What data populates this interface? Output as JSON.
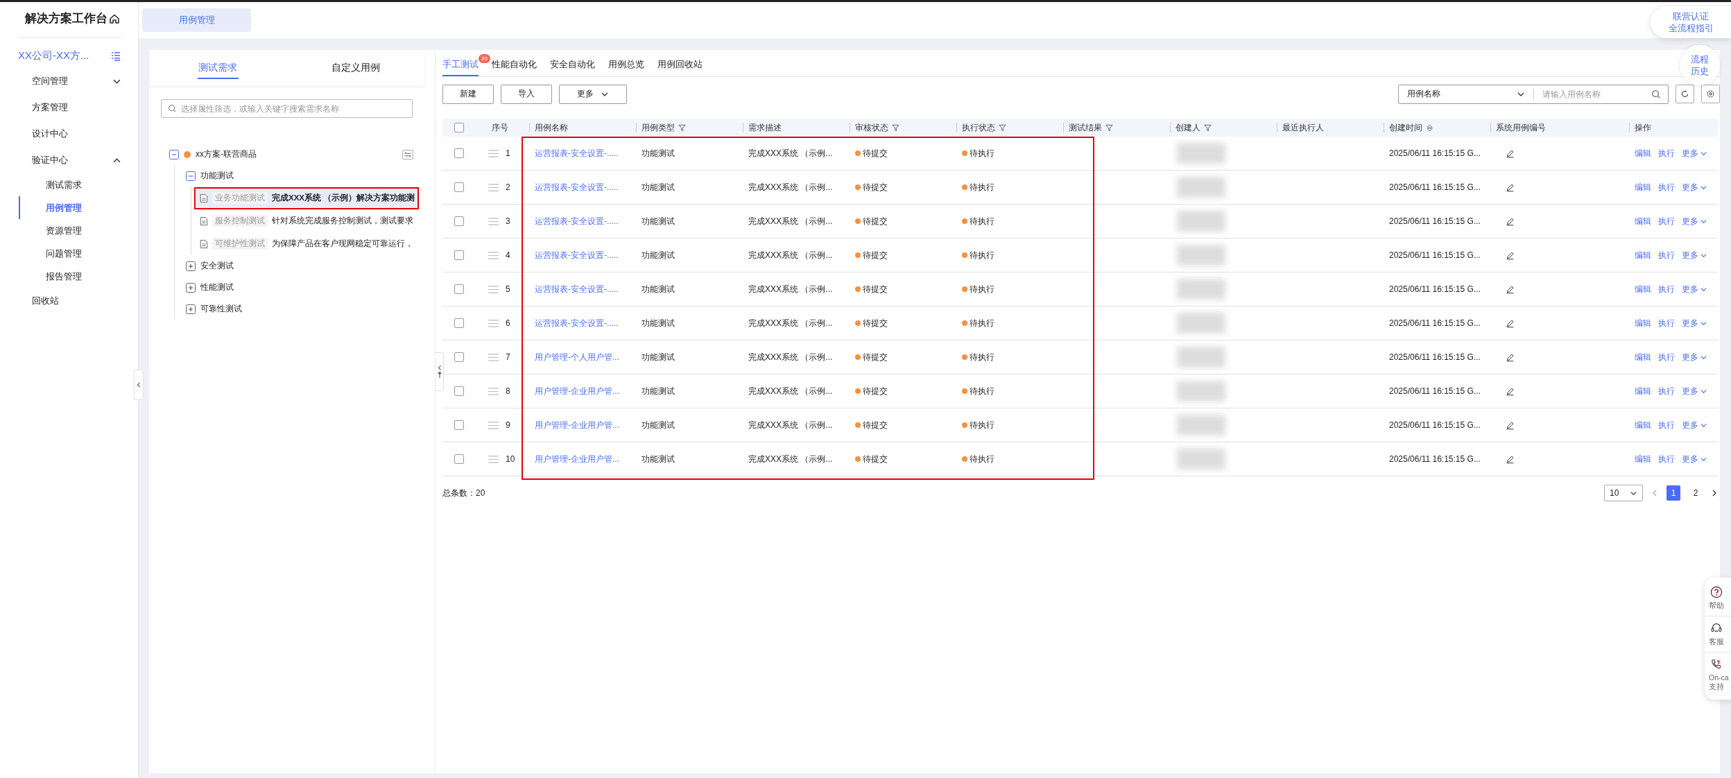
{
  "sidebar": {
    "title": "解决方案工作台",
    "project": "XX公司-XX方...",
    "items": [
      {
        "label": "空间管理",
        "expanded": false
      },
      {
        "label": "方案管理"
      },
      {
        "label": "设计中心"
      },
      {
        "label": "验证中心",
        "expanded": true,
        "children": [
          {
            "label": "测试需求",
            "selected": false
          },
          {
            "label": "用例管理",
            "selected": true
          },
          {
            "label": "资源管理",
            "selected": false
          },
          {
            "label": "问题管理",
            "selected": false
          },
          {
            "label": "报告管理",
            "selected": false
          }
        ]
      },
      {
        "label": "回收站"
      }
    ]
  },
  "top_tabs": [
    {
      "label": "用例管理",
      "selected": true
    }
  ],
  "guide_button": [
    "联营认证",
    "全流程指引"
  ],
  "tree_panel": {
    "tabs": [
      {
        "label": "测试需求",
        "selected": true
      },
      {
        "label": "自定义用例",
        "selected": false
      }
    ],
    "search": {
      "placeholder": "选择属性筛选，或输入关键字搜索需求名称"
    },
    "tree": [
      {
        "label": "xx方案-联营商品",
        "expanded": true,
        "children": [
          {
            "label": "功能测试",
            "expanded": true,
            "children": [
              {
                "tag": "业务功能测试",
                "text": "完成XXX系统 （示例）解决方案功能测",
                "selected": true,
                "framed": true
              },
              {
                "tag": "服务控制测试",
                "text": "针对系统完成服务控制测试，测试要求",
                "selected": false,
                "framed": false
              },
              {
                "tag": "可维护性测试",
                "text": "为保障产品在客户现网稳定可靠运行，",
                "selected": false,
                "framed": false
              }
            ]
          },
          {
            "label": "安全测试",
            "expanded": false
          },
          {
            "label": "性能测试",
            "expanded": false
          },
          {
            "label": "可靠性测试",
            "expanded": false
          }
        ]
      }
    ]
  },
  "case_tabs": [
    {
      "label": "手工测试",
      "selected": true,
      "badge": "20"
    },
    {
      "label": "性能自动化",
      "selected": false
    },
    {
      "label": "安全自动化",
      "selected": false
    },
    {
      "label": "用例总览",
      "selected": false
    },
    {
      "label": "用例回收站",
      "selected": false
    }
  ],
  "toolbar": {
    "buttons": [
      "新建",
      "导入"
    ],
    "more": "更多",
    "search": {
      "field": "用例名称",
      "placeholder": "请输入用例名称"
    }
  },
  "flow_history": [
    "流程",
    "历史"
  ],
  "table": {
    "framed": true,
    "all_checked": false,
    "columns": [
      {
        "label": "序号"
      },
      {
        "label": "用例名称"
      },
      {
        "label": "用例类型",
        "filter": true
      },
      {
        "label": "需求描述"
      },
      {
        "label": "审核状态",
        "filter": true
      },
      {
        "label": "执行状态",
        "filter": true
      },
      {
        "label": "测试结果",
        "filter": true
      },
      {
        "label": "创建人",
        "filter": true
      },
      {
        "label": "最近执行人"
      },
      {
        "label": "创建时间",
        "sort": true
      },
      {
        "label": "系统用例编号"
      },
      {
        "label": "操作"
      }
    ],
    "rows": [
      {
        "checked": false,
        "seq": "1",
        "name": "运营报表-安全设置-.....",
        "type": "功能测试",
        "desc": "完成XXX系统 （示例...",
        "review": "待提交",
        "exec": "待执行",
        "created": "2025/06/11 16:15:15 G...",
        "actions": [
          "编辑",
          "执行"
        ],
        "more": "更多"
      },
      {
        "checked": false,
        "seq": "2",
        "name": "运营报表-安全设置-.....",
        "type": "功能测试",
        "desc": "完成XXX系统 （示例...",
        "review": "待提交",
        "exec": "待执行",
        "created": "2025/06/11 16:15:15 G...",
        "actions": [
          "编辑",
          "执行"
        ],
        "more": "更多"
      },
      {
        "checked": false,
        "seq": "3",
        "name": "运营报表-安全设置-.....",
        "type": "功能测试",
        "desc": "完成XXX系统 （示例...",
        "review": "待提交",
        "exec": "待执行",
        "created": "2025/06/11 16:15:15 G...",
        "actions": [
          "编辑",
          "执行"
        ],
        "more": "更多"
      },
      {
        "checked": false,
        "seq": "4",
        "name": "运营报表-安全设置-.....",
        "type": "功能测试",
        "desc": "完成XXX系统 （示例...",
        "review": "待提交",
        "exec": "待执行",
        "created": "2025/06/11 16:15:15 G...",
        "actions": [
          "编辑",
          "执行"
        ],
        "more": "更多"
      },
      {
        "checked": false,
        "seq": "5",
        "name": "运营报表-安全设置-.....",
        "type": "功能测试",
        "desc": "完成XXX系统 （示例...",
        "review": "待提交",
        "exec": "待执行",
        "created": "2025/06/11 16:15:15 G...",
        "actions": [
          "编辑",
          "执行"
        ],
        "more": "更多"
      },
      {
        "checked": false,
        "seq": "6",
        "name": "运营报表-安全设置-.....",
        "type": "功能测试",
        "desc": "完成XXX系统 （示例...",
        "review": "待提交",
        "exec": "待执行",
        "created": "2025/06/11 16:15:15 G...",
        "actions": [
          "编辑",
          "执行"
        ],
        "more": "更多"
      },
      {
        "checked": false,
        "seq": "7",
        "name": "用户管理-个人用户管...",
        "type": "功能测试",
        "desc": "完成XXX系统 （示例...",
        "review": "待提交",
        "exec": "待执行",
        "created": "2025/06/11 16:15:15 G...",
        "actions": [
          "编辑",
          "执行"
        ],
        "more": "更多"
      },
      {
        "checked": false,
        "seq": "8",
        "name": "用户管理-企业用户管...",
        "type": "功能测试",
        "desc": "完成XXX系统 （示例...",
        "review": "待提交",
        "exec": "待执行",
        "created": "2025/06/11 16:15:15 G...",
        "actions": [
          "编辑",
          "执行"
        ],
        "more": "更多"
      },
      {
        "checked": false,
        "seq": "9",
        "name": "用户管理-企业用户管...",
        "type": "功能测试",
        "desc": "完成XXX系统 （示例...",
        "review": "待提交",
        "exec": "待执行",
        "created": "2025/06/11 16:15:15 G...",
        "actions": [
          "编辑",
          "执行"
        ],
        "more": "更多"
      },
      {
        "checked": false,
        "seq": "10",
        "name": "用户管理-企业用户管...",
        "type": "功能测试",
        "desc": "完成XXX系统 （示例...",
        "review": "待提交",
        "exec": "待执行",
        "created": "2025/06/11 16:15:15 G...",
        "actions": [
          "编辑",
          "执行"
        ],
        "more": "更多"
      }
    ]
  },
  "footer": {
    "total": "总条数：20",
    "page_size": "10",
    "pages": [
      {
        "label": "1",
        "selected": true
      },
      {
        "label": "2",
        "selected": false
      }
    ]
  },
  "float_tools": [
    {
      "kind": "help",
      "lines": [
        "帮助"
      ]
    },
    {
      "kind": "service",
      "lines": [
        "客服"
      ]
    },
    {
      "kind": "call",
      "lines": [
        "On-ca",
        "支持"
      ]
    }
  ]
}
